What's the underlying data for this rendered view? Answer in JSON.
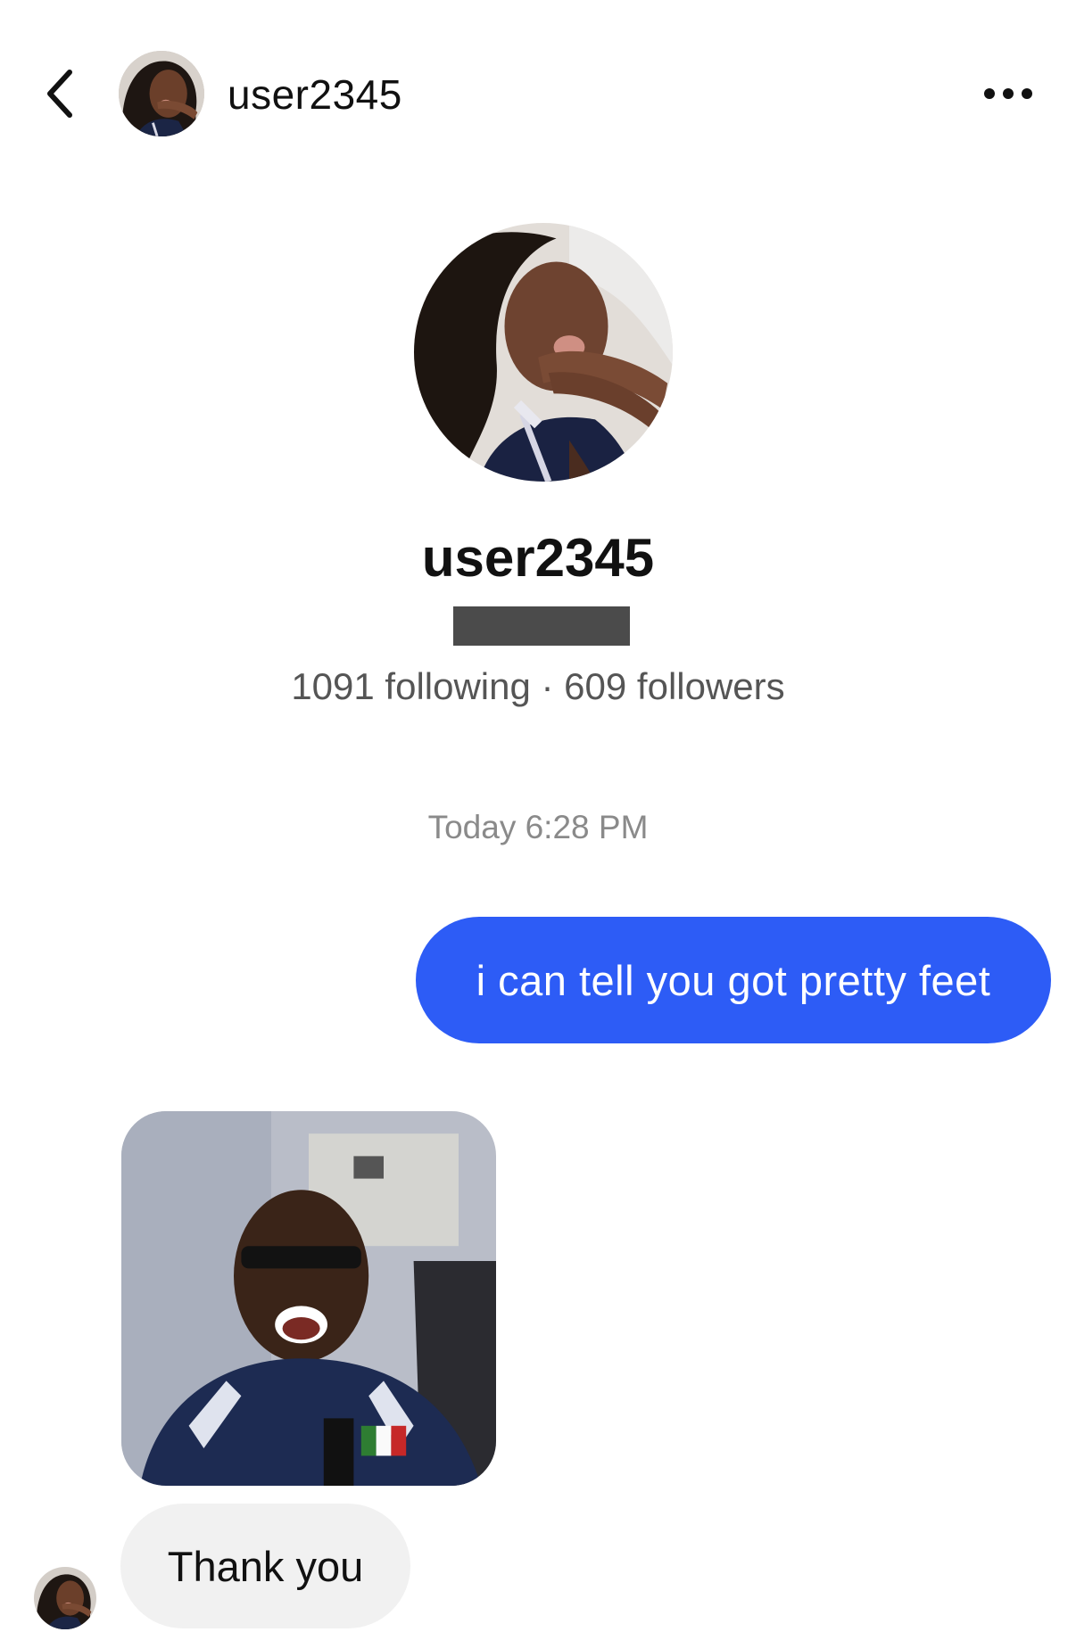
{
  "header": {
    "back_icon": "chevron-left-icon",
    "username": "user2345",
    "more_icon": "more-horizontal-icon"
  },
  "profile": {
    "username": "user2345",
    "following_count": "1091",
    "followers_count": "609",
    "stats_text": "1091 following · 609 followers"
  },
  "conversation": {
    "timestamp": "Today 6:28 PM",
    "messages": [
      {
        "direction": "outgoing",
        "type": "text",
        "text": "i can tell you got pretty feet"
      },
      {
        "direction": "incoming",
        "type": "image"
      },
      {
        "direction": "incoming",
        "type": "text",
        "text": "Thank you"
      }
    ]
  },
  "colors": {
    "outgoing_bubble": "#2d5cf6",
    "incoming_bubble": "#f1f1f1",
    "secondary_text": "#555555",
    "timestamp_text": "#8a8a8a"
  }
}
